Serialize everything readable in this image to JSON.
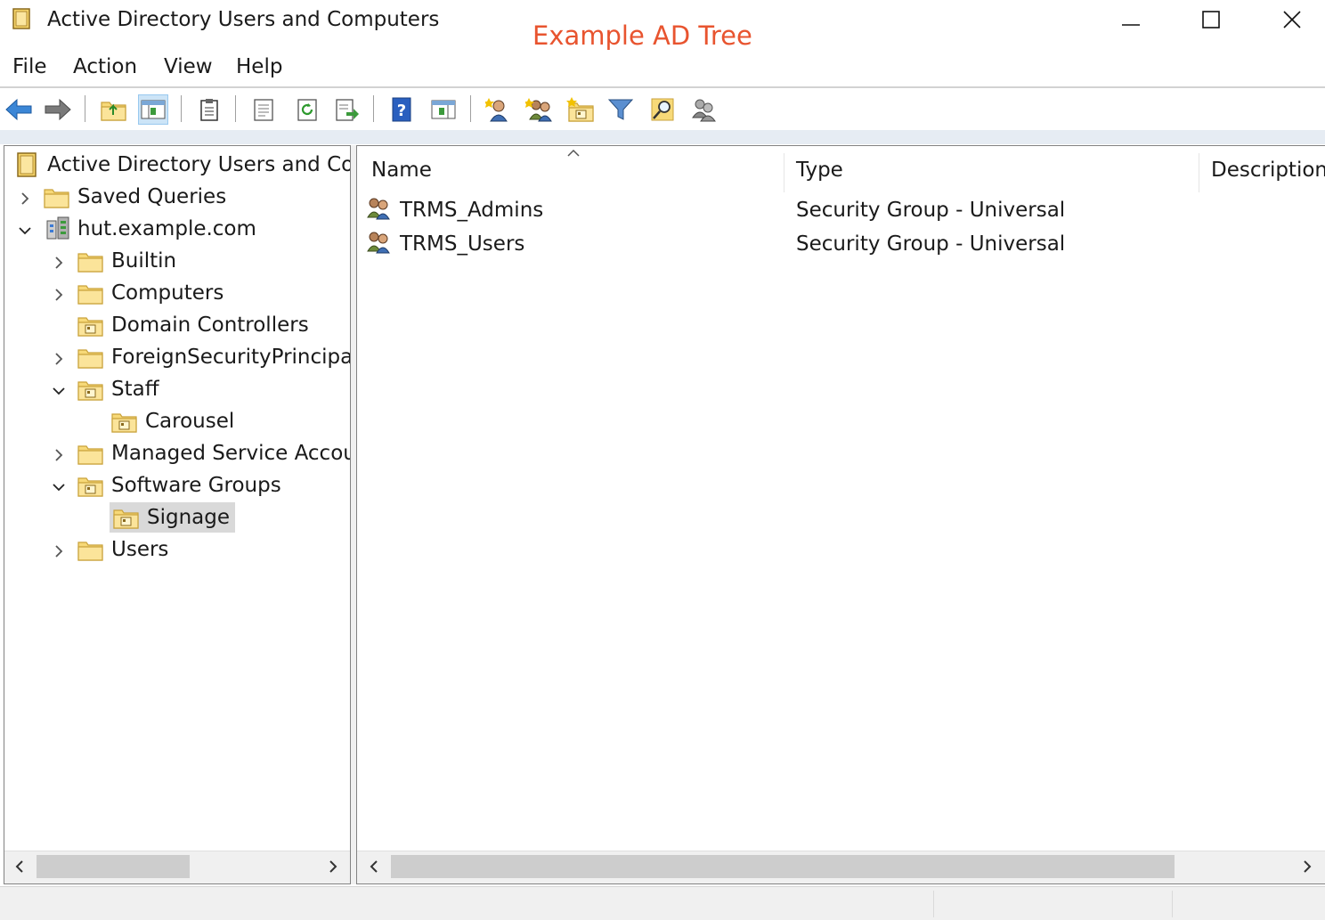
{
  "window": {
    "title": "Active Directory Users and Computers",
    "annotation": "Example AD Tree",
    "annotation_color": "#e8542f"
  },
  "menu": [
    "File",
    "Action",
    "View",
    "Help"
  ],
  "toolbar_icons": [
    "back-arrow-icon",
    "forward-arrow-icon",
    "up-folder-icon",
    "show-console-tree-icon",
    "clipboard-icon",
    "properties-icon",
    "refresh-icon",
    "export-list-icon",
    "help-icon",
    "show-action-pane-icon",
    "new-user-icon",
    "new-group-icon",
    "new-ou-icon",
    "filter-icon",
    "find-icon",
    "add-to-group-icon"
  ],
  "tree": {
    "root": "Active Directory Users and Com",
    "items": [
      {
        "label": "Saved Queries"
      },
      {
        "label": "hut.example.com"
      },
      {
        "label": "Builtin"
      },
      {
        "label": "Computers"
      },
      {
        "label": "Domain Controllers"
      },
      {
        "label": "ForeignSecurityPrincipals"
      },
      {
        "label": "Staff"
      },
      {
        "label": "Carousel"
      },
      {
        "label": "Managed Service Accour"
      },
      {
        "label": "Software Groups"
      },
      {
        "label": "Signage"
      },
      {
        "label": "Users"
      }
    ]
  },
  "list": {
    "columns": [
      "Name",
      "Type",
      "Description"
    ],
    "rows": [
      {
        "name": "TRMS_Admins",
        "type": "Security Group - Universal",
        "description": ""
      },
      {
        "name": "TRMS_Users",
        "type": "Security Group - Universal",
        "description": ""
      }
    ]
  }
}
